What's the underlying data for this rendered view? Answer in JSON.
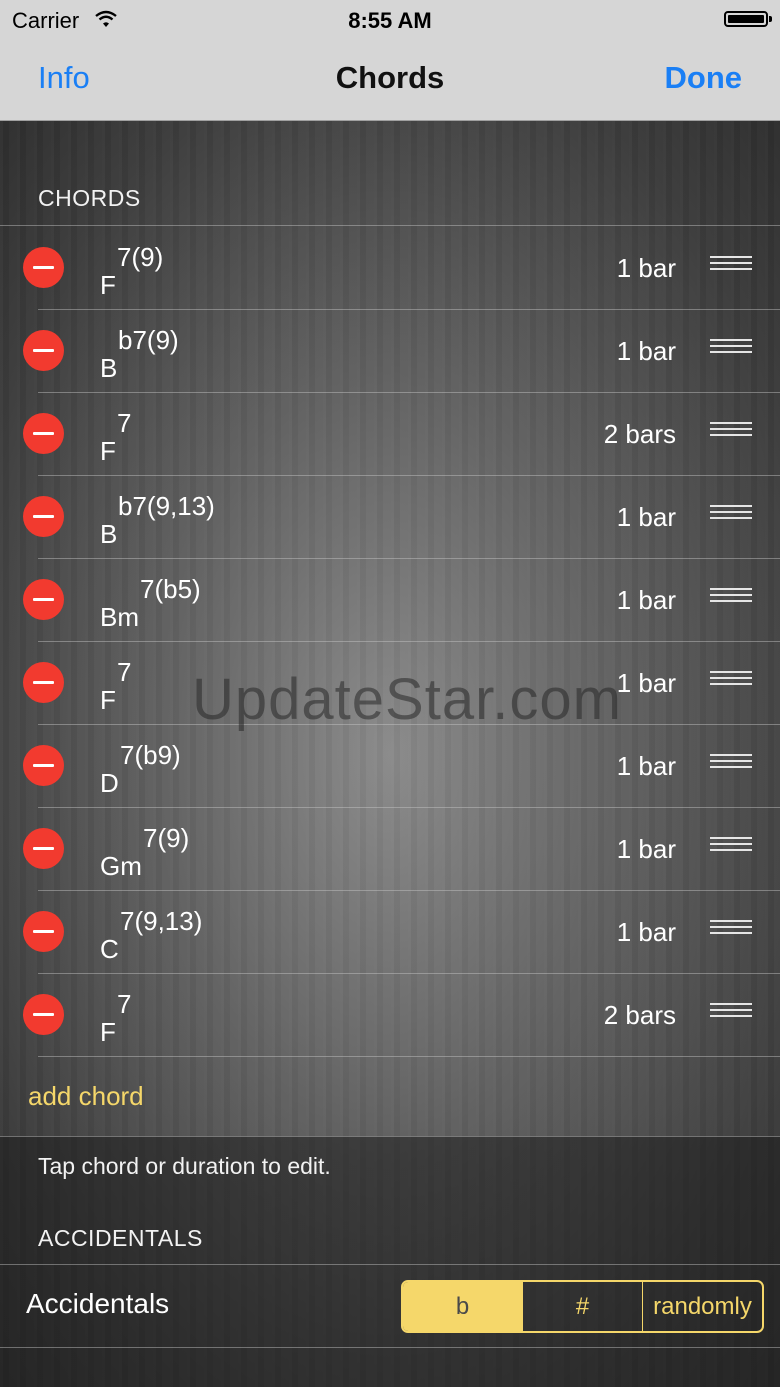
{
  "status_bar": {
    "carrier": "Carrier",
    "time": "8:55 AM"
  },
  "nav": {
    "info_label": "Info",
    "title": "Chords",
    "done_label": "Done"
  },
  "chords_section": {
    "header": "CHORDS"
  },
  "chords": [
    {
      "root": "F",
      "ext": "7(9)",
      "duration": "1 bar"
    },
    {
      "root": "B",
      "ext": "b7(9)",
      "duration": "1 bar"
    },
    {
      "root": "F",
      "ext": "7",
      "duration": "2 bars"
    },
    {
      "root": "B",
      "ext": "b7(9,13)",
      "duration": "1 bar"
    },
    {
      "root": "Bm",
      "ext": "7(b5)",
      "duration": "1 bar"
    },
    {
      "root": "F",
      "ext": "7",
      "duration": "1 bar"
    },
    {
      "root": "D",
      "ext": "7(b9)",
      "duration": "1 bar"
    },
    {
      "root": "Gm",
      "ext": "7(9)",
      "duration": "1 bar"
    },
    {
      "root": "C",
      "ext": "7(9,13)",
      "duration": "1 bar"
    },
    {
      "root": "F",
      "ext": "7",
      "duration": "2 bars"
    }
  ],
  "add_chord_label": "add chord",
  "footer_text": "Tap chord or duration to edit.",
  "accidentals_section": {
    "header": "ACCIDENTALS"
  },
  "accidentals": {
    "label": "Accidentals",
    "options": [
      "b",
      "#",
      "randomly"
    ],
    "selected": "b"
  },
  "watermark": "UpdateStar.com",
  "colors": {
    "accent": "#f5d76a",
    "delete": "#f23a2f",
    "link": "#1a7ff5"
  },
  "icons": {
    "delete": "minus-circle-icon",
    "reorder": "reorder-grip-icon",
    "wifi": "wifi-icon",
    "battery": "battery-icon"
  }
}
